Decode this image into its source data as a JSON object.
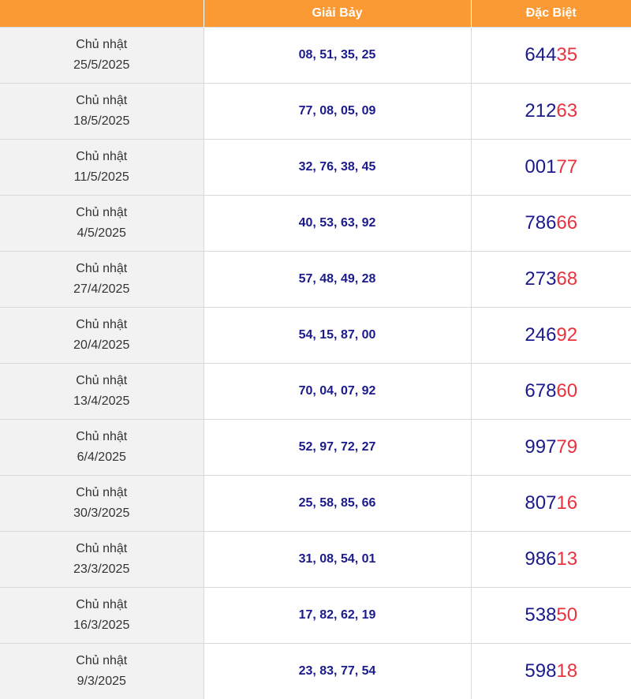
{
  "colors": {
    "header_bg": "#fb9a35",
    "header_text": "#ffffff",
    "date_bg": "#f2f2f2",
    "number_blue": "#1a1a8c",
    "number_red": "#e8333e"
  },
  "table": {
    "headers": [
      "",
      "Giải Bảy",
      "Đặc Biệt"
    ],
    "rows": [
      {
        "day": "Chủ nhật",
        "date": "25/5/2025",
        "g7": "08, 51, 35, 25",
        "db_head": "644",
        "db_tail": "35"
      },
      {
        "day": "Chủ nhật",
        "date": "18/5/2025",
        "g7": "77, 08, 05, 09",
        "db_head": "212",
        "db_tail": "63"
      },
      {
        "day": "Chủ nhật",
        "date": "11/5/2025",
        "g7": "32, 76, 38, 45",
        "db_head": "001",
        "db_tail": "77"
      },
      {
        "day": "Chủ nhật",
        "date": "4/5/2025",
        "g7": "40, 53, 63, 92",
        "db_head": "786",
        "db_tail": "66"
      },
      {
        "day": "Chủ nhật",
        "date": "27/4/2025",
        "g7": "57, 48, 49, 28",
        "db_head": "273",
        "db_tail": "68"
      },
      {
        "day": "Chủ nhật",
        "date": "20/4/2025",
        "g7": "54, 15, 87, 00",
        "db_head": "246",
        "db_tail": "92"
      },
      {
        "day": "Chủ nhật",
        "date": "13/4/2025",
        "g7": "70, 04, 07, 92",
        "db_head": "678",
        "db_tail": "60"
      },
      {
        "day": "Chủ nhật",
        "date": "6/4/2025",
        "g7": "52, 97, 72, 27",
        "db_head": "997",
        "db_tail": "79"
      },
      {
        "day": "Chủ nhật",
        "date": "30/3/2025",
        "g7": "25, 58, 85, 66",
        "db_head": "807",
        "db_tail": "16"
      },
      {
        "day": "Chủ nhật",
        "date": "23/3/2025",
        "g7": "31, 08, 54, 01",
        "db_head": "986",
        "db_tail": "13"
      },
      {
        "day": "Chủ nhật",
        "date": "16/3/2025",
        "g7": "17, 82, 62, 19",
        "db_head": "538",
        "db_tail": "50"
      },
      {
        "day": "Chủ nhật",
        "date": "9/3/2025",
        "g7": "23, 83, 77, 54",
        "db_head": "598",
        "db_tail": "18"
      }
    ]
  }
}
